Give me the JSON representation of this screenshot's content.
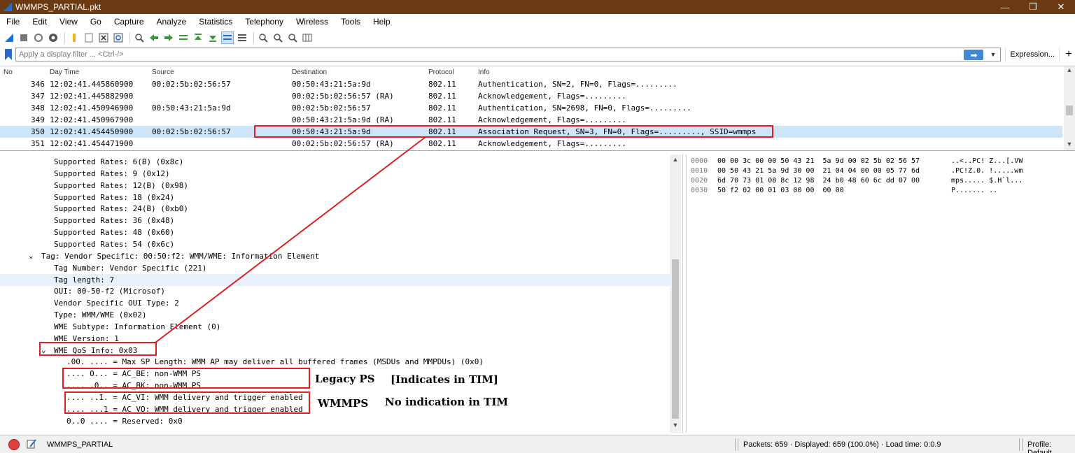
{
  "window": {
    "title": "WMMPS_PARTIAL.pkt",
    "minimize": "—",
    "maximize": "❐",
    "close": "✕"
  },
  "menu": [
    "File",
    "Edit",
    "View",
    "Go",
    "Capture",
    "Analyze",
    "Statistics",
    "Telephony",
    "Wireless",
    "Tools",
    "Help"
  ],
  "filter": {
    "placeholder": "Apply a display filter ... <Ctrl-/>",
    "expression_label": "Expression...",
    "add_label": "+"
  },
  "packet_list": {
    "columns": [
      "No",
      "Day Time",
      "Source",
      "Destination",
      "Protocol",
      "Info"
    ],
    "rows": [
      {
        "no": "346",
        "time": "12:02:41.445860900",
        "src": "00:02:5b:02:56:57",
        "dst": "00:50:43:21:5a:9d",
        "proto": "802.11",
        "info": "Authentication, SN=2, FN=0, Flags=........."
      },
      {
        "no": "347",
        "time": "12:02:41.445882900",
        "src": "",
        "dst": "00:02:5b:02:56:57 (RA)",
        "proto": "802.11",
        "info": "Acknowledgement, Flags=........."
      },
      {
        "no": "348",
        "time": "12:02:41.450946900",
        "src": "00:50:43:21:5a:9d",
        "dst": "00:02:5b:02:56:57",
        "proto": "802.11",
        "info": "Authentication, SN=2698, FN=0, Flags=........."
      },
      {
        "no": "349",
        "time": "12:02:41.450967900",
        "src": "",
        "dst": "00:50:43:21:5a:9d (RA)",
        "proto": "802.11",
        "info": "Acknowledgement, Flags=........."
      },
      {
        "no": "350",
        "time": "12:02:41.454450900",
        "src": "00:02:5b:02:56:57",
        "dst": "00:50:43:21:5a:9d",
        "proto": "802.11",
        "info": "Association Request, SN=3, FN=0, Flags=........., SSID=wmmps",
        "selected": true
      },
      {
        "no": "351",
        "time": "12:02:41.454471900",
        "src": "",
        "dst": "00:02:5b:02:56:57 (RA)",
        "proto": "802.11",
        "info": "Acknowledgement, Flags=........."
      }
    ]
  },
  "details": [
    {
      "indent": 77,
      "text": "Supported Rates: 6(B) (0x8c)"
    },
    {
      "indent": 77,
      "text": "Supported Rates: 9 (0x12)"
    },
    {
      "indent": 77,
      "text": "Supported Rates: 12(B) (0x98)"
    },
    {
      "indent": 77,
      "text": "Supported Rates: 18 (0x24)"
    },
    {
      "indent": 77,
      "text": "Supported Rates: 24(B) (0xb0)"
    },
    {
      "indent": 77,
      "text": "Supported Rates: 36 (0x48)"
    },
    {
      "indent": 77,
      "text": "Supported Rates: 48 (0x60)"
    },
    {
      "indent": 77,
      "text": "Supported Rates: 54 (0x6c)"
    },
    {
      "indent": 59,
      "text": "Tag: Vendor Specific: 00:50:f2: WMM/WME: Information Element",
      "expander": true
    },
    {
      "indent": 77,
      "text": "Tag Number: Vendor Specific (221)"
    },
    {
      "indent": 77,
      "text": "Tag length: 7",
      "selected": true
    },
    {
      "indent": 77,
      "text": "OUI: 00-50-f2 (Microsof)"
    },
    {
      "indent": 77,
      "text": "Vendor Specific OUI Type: 2"
    },
    {
      "indent": 77,
      "text": "Type: WMM/WME (0x02)"
    },
    {
      "indent": 77,
      "text": "WME Subtype: Information Element (0)"
    },
    {
      "indent": 77,
      "text": "WME Version: 1"
    },
    {
      "indent": 77,
      "text": "WME QoS Info: 0x03",
      "expander": true
    },
    {
      "indent": 95,
      "text": ".00. .... = Max SP Length: WMM AP may deliver all buffered frames (MSDUs and MMPDUs) (0x0)"
    },
    {
      "indent": 95,
      "text": ".... 0... = AC_BE: non-WMM PS"
    },
    {
      "indent": 95,
      "text": ".... .0.. = AC_BK: non-WMM PS"
    },
    {
      "indent": 95,
      "text": ".... ..1. = AC_VI: WMM delivery and trigger enabled"
    },
    {
      "indent": 95,
      "text": ".... ...1 = AC_VO: WMM delivery and trigger enabled"
    },
    {
      "indent": 95,
      "text": "0..0 .... = Reserved: 0x0"
    }
  ],
  "bytes": [
    {
      "offset": "0000",
      "hex": "00 00 3c 00 00 50 43 21  5a 9d 00 02 5b 02 56 57",
      "ascii": "..<..PC! Z...[.VW"
    },
    {
      "offset": "0010",
      "hex": "00 50 43 21 5a 9d 30 00  21 04 04 00 00 05 77 6d",
      "ascii": ".PC!Z.0. !.....wm"
    },
    {
      "offset": "0020",
      "hex": "6d 70 73 01 08 8c 12 98  24 b0 48 60 6c dd 07 00",
      "ascii": "mps..... $.H`l..."
    },
    {
      "offset": "0030",
      "hex": "50 f2 02 00 01 03 00 00  00 00",
      "ascii": "P....... .."
    }
  ],
  "annotations": {
    "legacy": "Legacy PS",
    "legacy_note": "[Indicates in TIM]",
    "wmmps": "WMMPS",
    "wmmps_note": "No indication in TIM"
  },
  "status": {
    "filename": "WMMPS_PARTIAL",
    "stats": "Packets: 659 · Displayed: 659 (100.0%) · Load time: 0:0.9",
    "profile": "Profile: Default"
  },
  "colors": {
    "titlebar": "#6b3a12",
    "selection": "#cde5f7",
    "annotation": "#e02020",
    "apply_button": "#3e8ad8"
  }
}
